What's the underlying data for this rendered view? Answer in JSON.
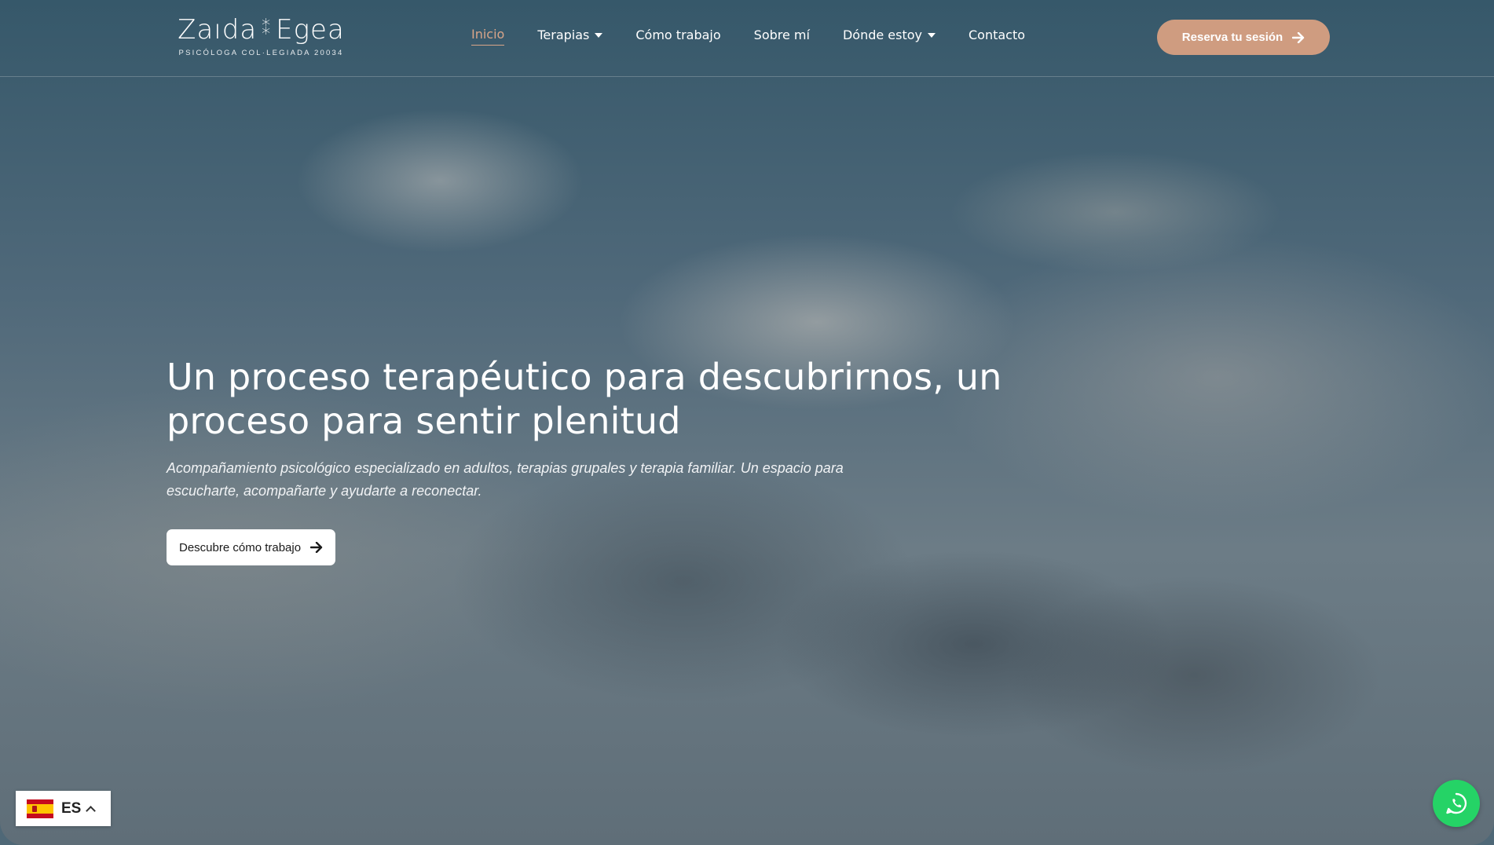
{
  "brand": {
    "name_left": "Zaıda",
    "separator": "⁑",
    "name_right": "Egea",
    "subtitle": "PSICÓLOGA COL·LEGIADA 20034"
  },
  "nav": {
    "items": [
      {
        "label": "Inicio",
        "active": true,
        "dropdown": false
      },
      {
        "label": "Terapias",
        "active": false,
        "dropdown": true
      },
      {
        "label": "Cómo trabajo",
        "active": false,
        "dropdown": false
      },
      {
        "label": "Sobre mí",
        "active": false,
        "dropdown": false
      },
      {
        "label": "Dónde estoy",
        "active": false,
        "dropdown": true
      },
      {
        "label": "Contacto",
        "active": false,
        "dropdown": false
      }
    ],
    "cta_label": "Reserva tu sesión"
  },
  "hero": {
    "title_line1": "Un proceso terapéutico para descubrirnos, un",
    "title_line2": "proceso para sentir plenitud",
    "subtitle_line1": "Acompañamiento psicológico especializado en adultos, terapias grupales y terapia familiar. Un espacio para",
    "subtitle_line2": "escucharte, acompañarte y ayudarte a reconectar.",
    "button_label": "Descubre cómo trabajo"
  },
  "language": {
    "code": "ES",
    "flag_icon": "spain-flag-icon"
  },
  "floating": {
    "whatsapp_icon": "whatsapp-icon"
  },
  "colors": {
    "accent": "#cf9c80",
    "active_nav": "#d9a589",
    "whatsapp": "#25d366"
  }
}
